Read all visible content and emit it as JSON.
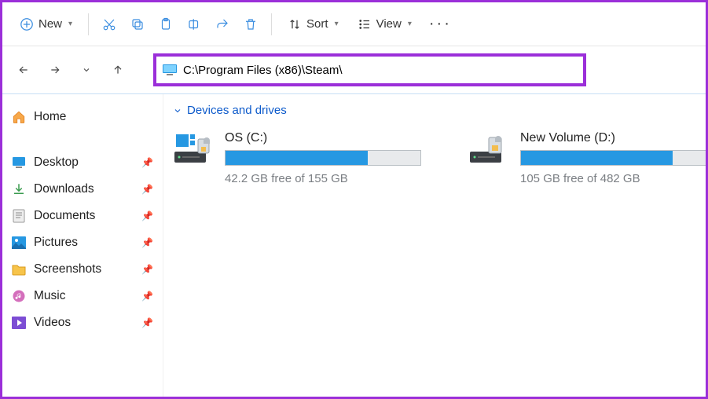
{
  "toolbar": {
    "new_label": "New",
    "sort_label": "Sort",
    "view_label": "View"
  },
  "address": {
    "path": "C:\\Program Files (x86)\\Steam\\"
  },
  "sidebar": {
    "items": [
      {
        "label": "Home",
        "icon": "home"
      },
      {
        "label": "Desktop",
        "icon": "desktop",
        "pinned": true
      },
      {
        "label": "Downloads",
        "icon": "downloads",
        "pinned": true
      },
      {
        "label": "Documents",
        "icon": "documents",
        "pinned": true
      },
      {
        "label": "Pictures",
        "icon": "pictures",
        "pinned": true
      },
      {
        "label": "Screenshots",
        "icon": "folder",
        "pinned": true
      },
      {
        "label": "Music",
        "icon": "music",
        "pinned": true
      },
      {
        "label": "Videos",
        "icon": "videos",
        "pinned": true
      }
    ]
  },
  "content": {
    "group_label": "Devices and drives",
    "drives": [
      {
        "name": "OS (C:)",
        "free": "42.2 GB free of 155 GB",
        "fill_pct": 73
      },
      {
        "name": "New Volume (D:)",
        "free": "105 GB free of 482 GB",
        "fill_pct": 78
      }
    ]
  }
}
